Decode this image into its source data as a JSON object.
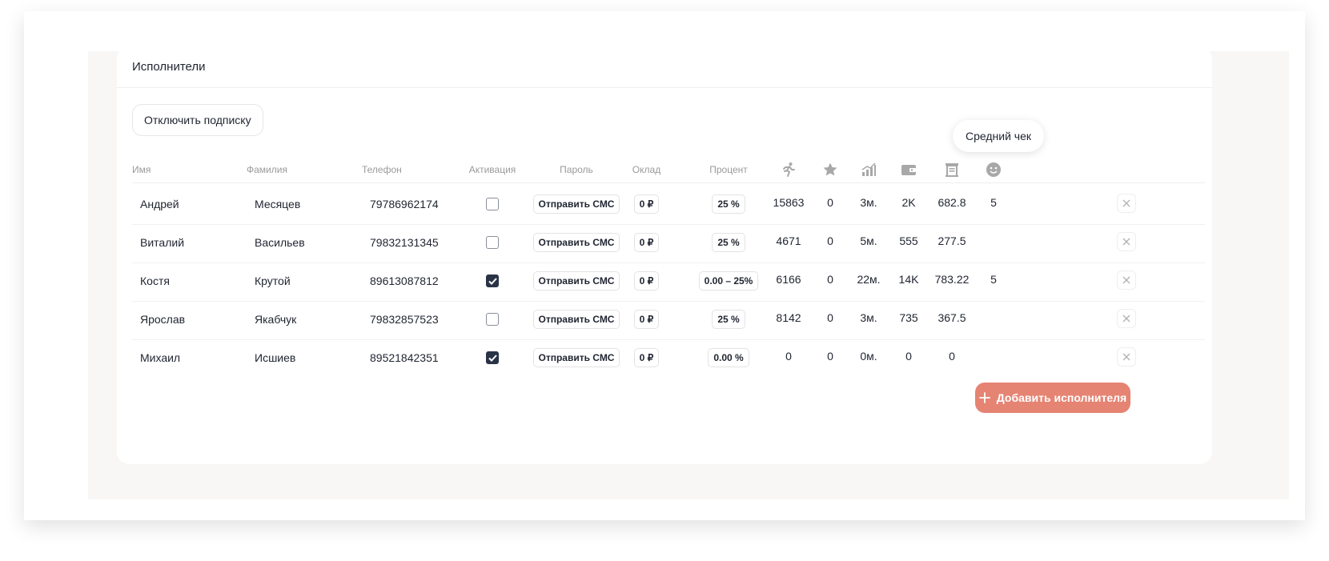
{
  "card": {
    "title": "Исполнители",
    "unsubscribe_label": "Отключить подписку",
    "add_label": "Добавить исполнителя"
  },
  "tooltip": {
    "text": "Средний чек"
  },
  "columns": {
    "first_name": "Имя",
    "last_name": "Фамилия",
    "phone": "Телефон",
    "activation": "Активация",
    "password": "Пароль",
    "salary": "Оклад",
    "percent": "Процент",
    "icons": [
      "running-icon",
      "star-icon",
      "growth-chart-icon",
      "wallet-icon",
      "receipt-icon",
      "smiley-icon"
    ]
  },
  "rows": [
    {
      "first_name": "Андрей",
      "last_name": "Месяцев",
      "phone": "79786962174",
      "activated": false,
      "password_btn": "Отправить СМС",
      "salary": "0 ₽",
      "percent": "25 %",
      "runs": "15863",
      "stars": "0",
      "tenure": "3м.",
      "wallet": "2K",
      "avg_check": "682.8",
      "rating": "5"
    },
    {
      "first_name": "Виталий",
      "last_name": "Васильев",
      "phone": "79832131345",
      "activated": false,
      "password_btn": "Отправить СМС",
      "salary": "0 ₽",
      "percent": "25 %",
      "runs": "4671",
      "stars": "0",
      "tenure": "5м.",
      "wallet": "555",
      "avg_check": "277.5",
      "rating": ""
    },
    {
      "first_name": "Костя",
      "last_name": "Крутой",
      "phone": "89613087812",
      "activated": true,
      "password_btn": "Отправить СМС",
      "salary": "0 ₽",
      "percent": "0.00 – 25%",
      "runs": "6166",
      "stars": "0",
      "tenure": "22м.",
      "wallet": "14K",
      "avg_check": "783.22",
      "rating": "5"
    },
    {
      "first_name": "Ярослав",
      "last_name": "Якабчук",
      "phone": "79832857523",
      "activated": false,
      "password_btn": "Отправить СМС",
      "salary": "0 ₽",
      "percent": "25 %",
      "runs": "8142",
      "stars": "0",
      "tenure": "3м.",
      "wallet": "735",
      "avg_check": "367.5",
      "rating": ""
    },
    {
      "first_name": "Михаил",
      "last_name": "Исшиев",
      "phone": "89521842351",
      "activated": true,
      "password_btn": "Отправить СМС",
      "salary": "0 ₽",
      "percent": "0.00 %",
      "runs": "0",
      "stars": "0",
      "tenure": "0м.",
      "wallet": "0",
      "avg_check": "0",
      "rating": ""
    }
  ],
  "colors": {
    "accent": "#e58473",
    "checkbox_on": "#2a3346",
    "icon_gray": "#a8a8a8"
  }
}
